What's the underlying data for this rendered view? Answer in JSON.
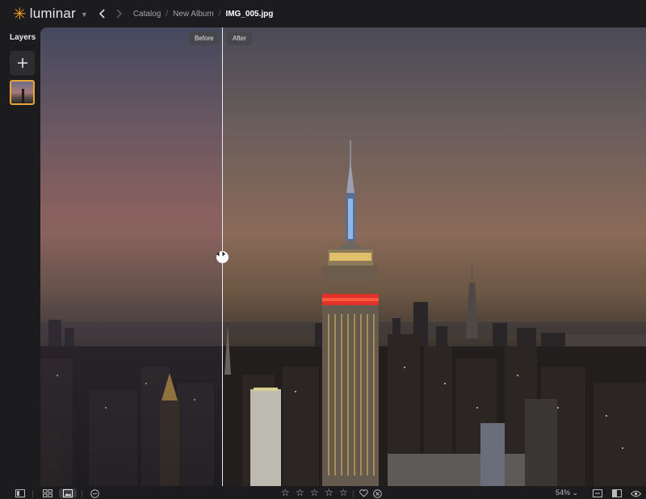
{
  "app": {
    "brand": "luminar",
    "brand_color": "#f0a020"
  },
  "breadcrumb": {
    "items": [
      "Catalog",
      "New Album"
    ],
    "current": "IMG_005.jpg"
  },
  "layers": {
    "title": "Layers",
    "add_icon": "plus-icon",
    "selected_layer": 1
  },
  "compare": {
    "before_label": "Before",
    "after_label": "After",
    "split_handle_icon": "split-arrows-icon"
  },
  "bottom_bar": {
    "left_icons": [
      "sidebar-toggle-icon",
      "grid-view-icon",
      "single-view-icon",
      "minus-circle-icon"
    ],
    "rating_stars": 5,
    "rating_value": 0,
    "flag_icons": [
      "heart-icon",
      "reject-icon"
    ],
    "zoom_label": "54%",
    "right_icons": [
      "compare-icon",
      "before-after-icon",
      "eye-icon"
    ]
  },
  "colors": {
    "accent": "#e8a33a",
    "background": "#1c1c1e"
  }
}
